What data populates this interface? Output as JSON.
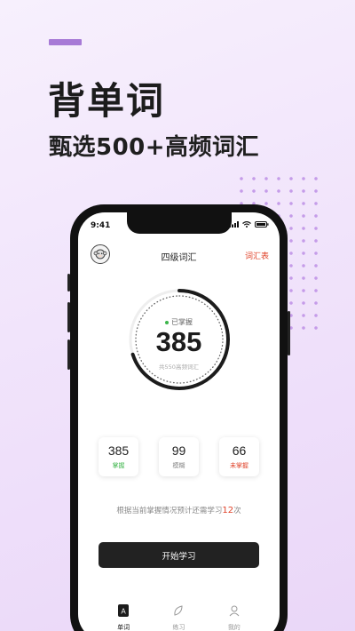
{
  "promo": {
    "headline": "背单词",
    "subheadline": "甄选500+高频词汇"
  },
  "status_bar": {
    "time": "9:41"
  },
  "header": {
    "title": "四级词汇",
    "vocab_link": "词汇表"
  },
  "progress": {
    "mastered_label": "已掌握",
    "mastered_count": "385",
    "total_label": "共550高频词汇",
    "fraction": 0.7
  },
  "stats": [
    {
      "value": "385",
      "label": "掌握",
      "color": "#3cb54a"
    },
    {
      "value": "99",
      "label": "模糊",
      "color": "#888888"
    },
    {
      "value": "66",
      "label": "未掌握",
      "color": "#e0432a"
    }
  ],
  "hint": {
    "prefix": "根据当前掌握情况预计还需学习",
    "count": "12",
    "suffix": "次"
  },
  "start_button": "开始学习",
  "tabs": [
    {
      "label": "单词",
      "icon": "word-card-icon"
    },
    {
      "label": "练习",
      "icon": "leaf-icon"
    },
    {
      "label": "我的",
      "icon": "profile-icon"
    }
  ],
  "colors": {
    "accent": "#a77ad6",
    "alert": "#e0432a",
    "mastered": "#3cb54a"
  }
}
